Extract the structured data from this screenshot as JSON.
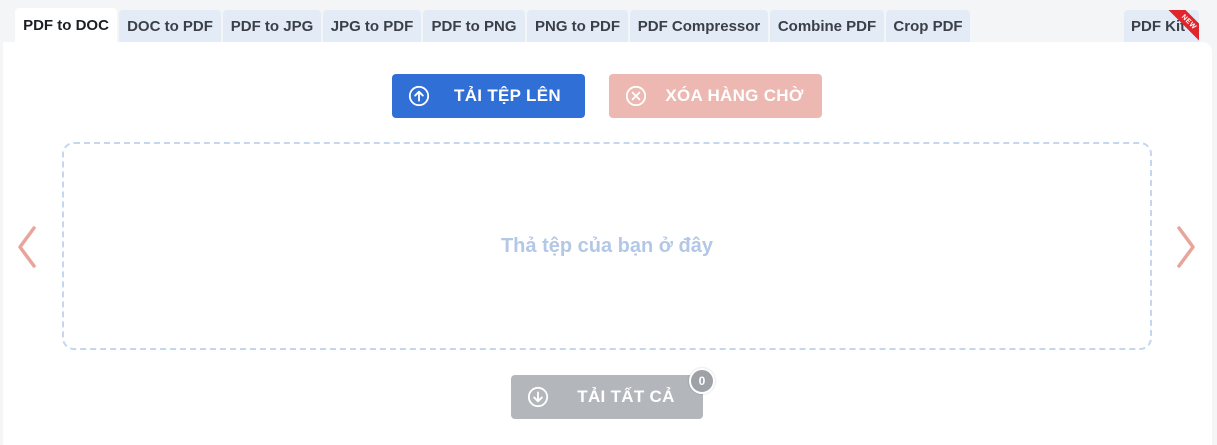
{
  "tabs": [
    {
      "label": "PDF to DOC",
      "active": true
    },
    {
      "label": "DOC to PDF"
    },
    {
      "label": "PDF to JPG"
    },
    {
      "label": "JPG to PDF"
    },
    {
      "label": "PDF to PNG"
    },
    {
      "label": "PNG to PDF"
    },
    {
      "label": "PDF Compressor"
    },
    {
      "label": "Combine PDF"
    },
    {
      "label": "Crop PDF"
    },
    {
      "label": "PDF Kit",
      "badge": "NEW"
    }
  ],
  "toolbar": {
    "upload_label": "TẢI TỆP LÊN",
    "clear_label": "XÓA HÀNG CHỜ"
  },
  "dropzone": {
    "text": "Thả tệp của bạn ở đây"
  },
  "download": {
    "label": "TẢI TẤT CẢ",
    "count": "0"
  },
  "colors": {
    "tab_bg": "#e3ebf7",
    "upload": "#2f6fd6",
    "clear": "#ecb8b1",
    "download": "#b3b6bb",
    "arrow": "#e8a59a",
    "new_badge": "#e0262c"
  },
  "icons": {
    "upload": "arrow-up-circle-icon",
    "clear": "x-circle-icon",
    "download": "arrow-down-circle-icon",
    "prev": "chevron-left-icon",
    "next": "chevron-right-icon"
  }
}
